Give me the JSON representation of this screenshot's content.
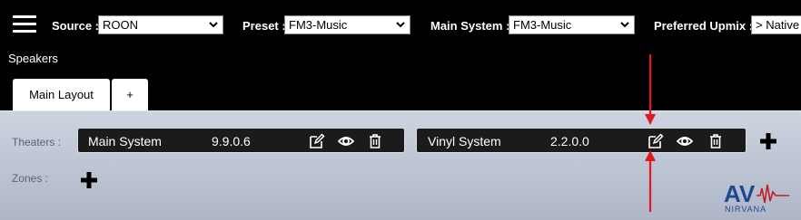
{
  "header": {
    "source": {
      "label": "Source :",
      "value": "ROON"
    },
    "preset": {
      "label": "Preset :",
      "value": "FM3-Music"
    },
    "main_system": {
      "label": "Main System :",
      "value": "FM3-Music"
    },
    "preferred_upmix": {
      "label": "Preferred Upmix :",
      "value": "> Native"
    }
  },
  "speakers_label": "Speakers",
  "tabs": [
    {
      "label": "Main Layout",
      "active": true
    },
    {
      "label": "+",
      "active": false
    }
  ],
  "theaters": {
    "label": "Theaters :",
    "systems": [
      {
        "name": "Main System",
        "version": "9.9.0.6"
      },
      {
        "name": "Vinyl System",
        "version": "2.2.0.0"
      }
    ]
  },
  "zones": {
    "label": "Zones :"
  },
  "logo": {
    "text_top": "AV",
    "text_bottom": "NIRVANA"
  },
  "colors": {
    "annotation_arrow": "#e0191f",
    "system_bar": "#1b1b1b",
    "panel_top": "#cdd3df",
    "panel_bottom": "#aeb6c8"
  },
  "icons": [
    "menu-icon",
    "chevron-down-icon",
    "edit-icon",
    "eye-icon",
    "trash-icon",
    "plus-icon"
  ]
}
